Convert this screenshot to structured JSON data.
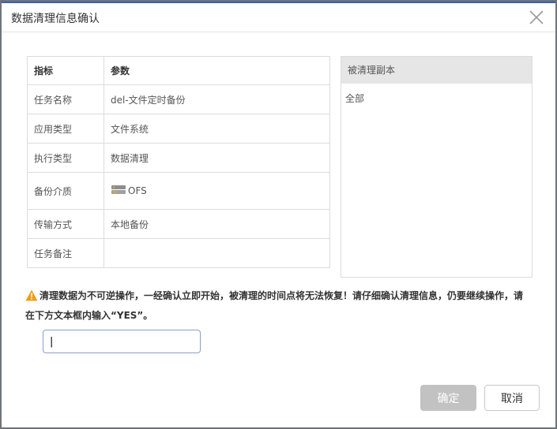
{
  "dialog": {
    "title": "数据清理信息确认"
  },
  "table": {
    "headers": [
      "指标",
      "参数"
    ],
    "rows": [
      {
        "key": "任务名称",
        "value": "del-文件定时备份"
      },
      {
        "key": "应用类型",
        "value": "文件系统"
      },
      {
        "key": "执行类型",
        "value": "数据清理"
      },
      {
        "key": "备份介质",
        "value": "OFS"
      },
      {
        "key": "传输方式",
        "value": "本地备份"
      },
      {
        "key": "任务备注",
        "value": ""
      }
    ]
  },
  "replica": {
    "header": "被清理副本",
    "items": [
      "全部"
    ]
  },
  "warning": {
    "text": "清理数据为不可逆操作，一经确认立即开始，被清理的时间点将无法恢复！请仔细确认清理信息，仍要继续操作，请在下方文本框内输入“YES”。"
  },
  "input": {
    "value": "|"
  },
  "buttons": {
    "ok": "确定",
    "cancel": "取消"
  },
  "colors": {
    "accent": "#3b5fb1",
    "warning": "#f39c12",
    "disabled_button": "#c2c2c2"
  }
}
